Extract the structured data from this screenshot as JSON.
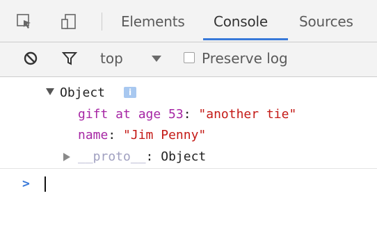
{
  "tabs": [
    {
      "label": "Elements"
    },
    {
      "label": "Console",
      "active": true
    },
    {
      "label": "Sources"
    }
  ],
  "toolbar_icons": [
    "inspect-element-icon",
    "device-toolbar-icon"
  ],
  "filter_bar": {
    "icons": [
      "clear-console-icon",
      "filter-icon"
    ],
    "context": "top",
    "preserve_log_label": "Preserve log",
    "preserve_log_checked": false
  },
  "console": {
    "object_label": "Object",
    "info_badge": "i",
    "properties": [
      {
        "key": "gift at age 53",
        "separator": ": ",
        "value": "\"another tie\""
      },
      {
        "key": "name",
        "separator": ": ",
        "value": "\"Jim Penny\""
      }
    ],
    "proto": {
      "key": "__proto__",
      "separator": ": ",
      "value": "Object"
    },
    "prompt": ">"
  },
  "colors": {
    "accent": "#3879d9",
    "property_key": "#a626a4",
    "string_value": "#c41a16"
  }
}
